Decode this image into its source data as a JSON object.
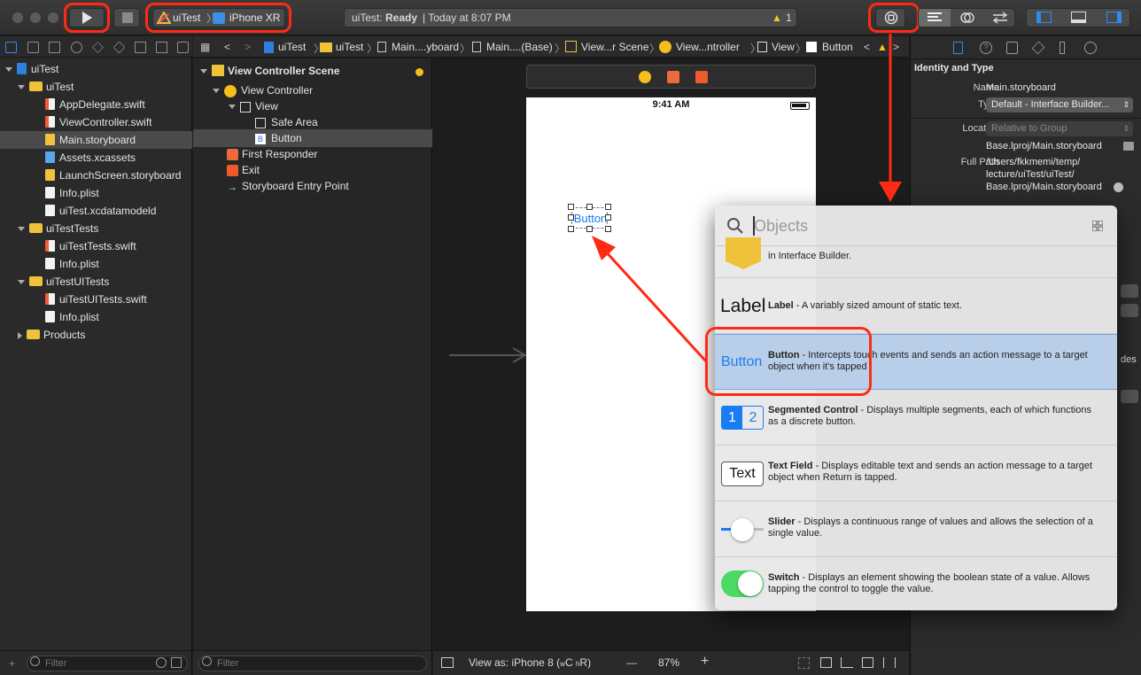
{
  "toolbar": {
    "scheme_app": "uiTest",
    "scheme_device": "iPhone XR",
    "status_app": "uiTest:",
    "status_state": "Ready",
    "status_time": "| Today at 8:07 PM",
    "warning_count": "1"
  },
  "navigator": {
    "items": [
      {
        "label": "uiTest",
        "type": "proj"
      },
      {
        "label": "uiTest",
        "type": "folder"
      },
      {
        "label": "AppDelegate.swift",
        "type": "swift"
      },
      {
        "label": "ViewController.swift",
        "type": "swift"
      },
      {
        "label": "Main.storyboard",
        "type": "sb"
      },
      {
        "label": "Assets.xcassets",
        "type": "xcassets"
      },
      {
        "label": "LaunchScreen.storyboard",
        "type": "sb"
      },
      {
        "label": "Info.plist",
        "type": "file"
      },
      {
        "label": "uiTest.xcdatamodeld",
        "type": "file"
      },
      {
        "label": "uiTestTests",
        "type": "folder"
      },
      {
        "label": "uiTestTests.swift",
        "type": "swift"
      },
      {
        "label": "Info.plist",
        "type": "file"
      },
      {
        "label": "uiTestUITests",
        "type": "folder"
      },
      {
        "label": "uiTestUITests.swift",
        "type": "swift"
      },
      {
        "label": "Info.plist",
        "type": "file"
      },
      {
        "label": "Products",
        "type": "folder"
      }
    ],
    "filter_placeholder": "Filter"
  },
  "jumpbar": {
    "crumbs": [
      "uiTest",
      "uiTest",
      "Main....yboard",
      "Main....(Base)",
      "View...r Scene",
      "View...ntroller",
      "View",
      "Button"
    ]
  },
  "outline": {
    "items": [
      {
        "label": "View Controller Scene"
      },
      {
        "label": "View Controller"
      },
      {
        "label": "View"
      },
      {
        "label": "Safe Area"
      },
      {
        "label": "Button"
      },
      {
        "label": "First Responder"
      },
      {
        "label": "Exit"
      },
      {
        "label": "Storyboard Entry Point"
      }
    ],
    "filter_placeholder": "Filter"
  },
  "canvas": {
    "status_time": "9:41 AM",
    "button_text": "Button",
    "view_as": "View as: iPhone 8 (",
    "view_as_w": "w",
    "view_as_c": "C",
    "view_as_h": "h",
    "view_as_r": "R)",
    "zoom": "87%",
    "zoom_minus": "—",
    "zoom_plus": "+"
  },
  "inspector": {
    "section_title": "Identity and Type",
    "name_label": "Name",
    "name_value": "Main.storyboard",
    "type_label": "Type",
    "type_value": "Default - Interface Builder...",
    "location_label": "Location",
    "location_value": "Relative to Group",
    "location_path": "Base.lproj/Main.storyboard",
    "fullpath_label": "Full Path",
    "fullpath_line1": "/Users/fkkmemi/temp/",
    "fullpath_line2": "lecture/uiTest/uiTest/",
    "fullpath_line3": "Base.lproj/Main.storyboard",
    "clipped_text": "des"
  },
  "library": {
    "search_placeholder": "Objects",
    "top_row_desc": "in Interface Builder.",
    "rows": [
      {
        "preview": "Label",
        "title": "Label",
        "desc": " - A variably sized amount of static text."
      },
      {
        "preview": "Button",
        "title": "Button",
        "desc": " - Intercepts touch events and sends an action message to a target object when it's tapped"
      },
      {
        "preview_1": "1",
        "preview_2": "2",
        "title": "Segmented Control",
        "desc": " - Displays multiple segments, each of which functions as a discrete button."
      },
      {
        "preview": "Text",
        "title": "Text Field",
        "desc": " - Displays editable text and sends an action message to a target object when Return is tapped."
      },
      {
        "title": "Slider",
        "desc": " - Displays a continuous range of values and allows the selection of a single value."
      },
      {
        "title": "Switch",
        "desc": " - Displays an element showing the boolean state of a value. Allows tapping the control to toggle the value."
      }
    ]
  },
  "colors": {
    "annotation_red": "#ff2a14",
    "ios_blue": "#1a7cf2",
    "switch_green": "#4cd964",
    "folder_yellow": "#f0c23c",
    "selected_row_blue": "#b9cfe9"
  }
}
